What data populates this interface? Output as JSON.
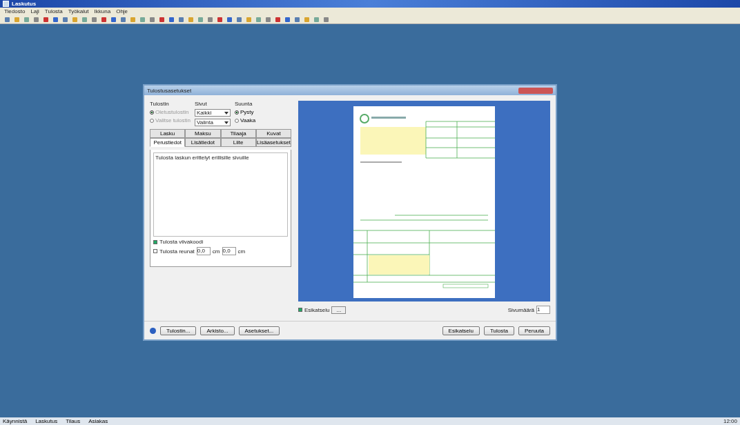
{
  "window": {
    "title": "Laskutus"
  },
  "menu": [
    "Tiedosto",
    "Laji",
    "Tulosta",
    "Työkalut",
    "Ikkuna",
    "Ohje"
  ],
  "dialog": {
    "title": "Tulostusasetukset",
    "printer": {
      "label": "Tulostin",
      "options": [
        {
          "label": "Oletustulostin",
          "selected": true,
          "disabled": true
        },
        {
          "label": "Valitse tulostin",
          "selected": false,
          "disabled": true
        }
      ]
    },
    "pages": {
      "label": "Sivut",
      "dropdowns": [
        "Kaikki",
        "Valinta"
      ]
    },
    "orientation": {
      "label": "Suunta",
      "options": [
        {
          "label": "Pysty",
          "selected": true
        },
        {
          "label": "Vaaka",
          "selected": false
        }
      ]
    },
    "tab_rows": [
      [
        {
          "label": "Lasku",
          "selected": false
        },
        {
          "label": "Maksu",
          "selected": false
        },
        {
          "label": "Tilaaja",
          "selected": false
        },
        {
          "label": "Kuvat",
          "selected": false
        }
      ],
      [
        {
          "label": "Perustiedot",
          "selected": true
        },
        {
          "label": "Lisätiedot",
          "selected": false
        },
        {
          "label": "Liite",
          "selected": false
        },
        {
          "label": "Lisäasetukset",
          "selected": false
        }
      ]
    ],
    "note": "Tulosta laskun erittelyt erillisille sivuille",
    "checks": [
      {
        "label": "Tulosta viivakoodi",
        "checked": true,
        "kind": "plain"
      },
      {
        "label": "Tulosta reunat",
        "checked": false,
        "kind": "margins",
        "fields": [
          {
            "value": "0,0",
            "unit": "cm"
          },
          {
            "value": "0,0",
            "unit": "cm"
          }
        ]
      }
    ],
    "preview_toggle": {
      "label": "Esikatselu",
      "checked": true,
      "button": "..."
    },
    "copies": {
      "label": "Sivumäärä",
      "value": "1"
    },
    "left_buttons": [
      "Tulostin...",
      "Arkisto...",
      "Asetukset..."
    ],
    "right_buttons": [
      "Esikatselu",
      "Tulosta",
      "Peruuta"
    ]
  },
  "taskbar": [
    "Käynnistä",
    "Laskutus",
    "Tilaus",
    "Asiakas"
  ],
  "clock": "12:00"
}
